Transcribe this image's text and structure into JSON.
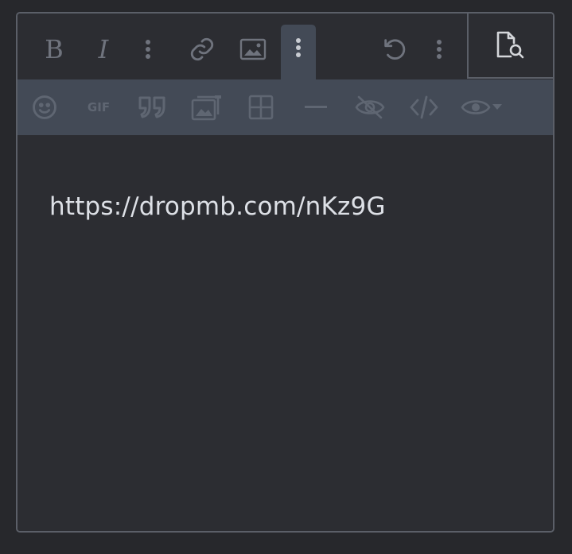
{
  "toolbar": {
    "primary": [
      {
        "name": "bold",
        "label": "B"
      },
      {
        "name": "italic",
        "label": "I"
      },
      {
        "name": "more-text-options"
      },
      {
        "name": "link"
      },
      {
        "name": "image"
      },
      {
        "name": "more-insert-options",
        "active": true
      },
      {
        "name": "undo"
      },
      {
        "name": "more-options"
      }
    ],
    "preview": {
      "name": "preview"
    },
    "secondary": [
      {
        "name": "emoji"
      },
      {
        "name": "gif",
        "label": "GIF"
      },
      {
        "name": "quote"
      },
      {
        "name": "media"
      },
      {
        "name": "table"
      },
      {
        "name": "horizontal-line"
      },
      {
        "name": "spoiler"
      },
      {
        "name": "code"
      },
      {
        "name": "visibility-dropdown"
      }
    ]
  },
  "editor": {
    "text": "https://dropmb.com/nKz9G"
  },
  "colors": {
    "background": "#27282c",
    "editor": "#2c2d32",
    "toolbar_secondary": "#434a56",
    "border": "#5b5f68",
    "icon_muted": "#6f737d",
    "text": "#dde0e6"
  }
}
